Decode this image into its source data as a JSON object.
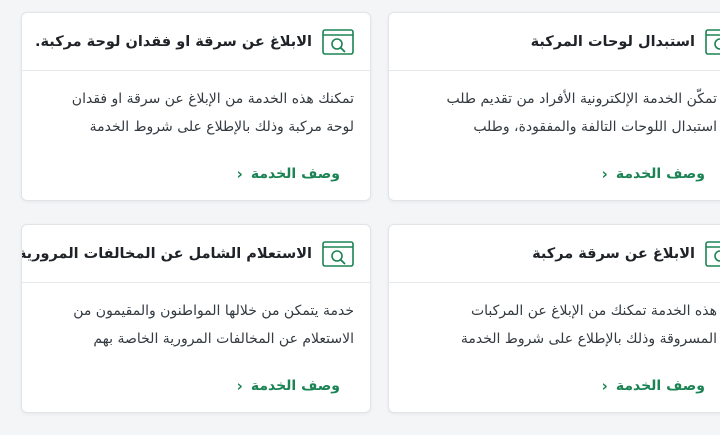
{
  "cards": [
    {
      "title": "الابلاغ عن سرقة او فقدان لوحة مركبة.",
      "line1": "تمكنك هذه الخدمة من الإبلاغ عن سرقة او فقدان",
      "line2": "لوحة مركبة وذلك بالإطلاع على شروط الخدمة",
      "link": "وصف الخدمة",
      "chevron": "‹"
    },
    {
      "title": "استبدال لوحات المركبة",
      "line1": "تمكّن الخدمة الإلكترونية الأفراد من تقديم طلب",
      "line2": "استبدال اللوحات التالفة والمفقودة، وطلب",
      "link": "وصف الخدمة",
      "chevron": "‹"
    },
    {
      "title": "الاستعلام الشامل عن المخالفات المرورية",
      "line1": "خدمة يتمكن من خلالها المواطنون والمقيمون من",
      "line2": "الاستعلام عن المخالفات المرورية الخاصة بهم",
      "link": "وصف الخدمة",
      "chevron": "‹"
    },
    {
      "title": "الابلاغ عن سرقة مركبة",
      "line1": "هذه الخدمة تمكنك من الإبلاغ عن المركبات",
      "line2": "المسروقة وذلك بالإطلاع على شروط الخدمة",
      "link": "وصف الخدمة",
      "chevron": "‹"
    }
  ],
  "colors": {
    "accent": "#1b8354",
    "border": "#e2e5e8",
    "background": "#f4f5f6"
  },
  "icon_name": "service-search-icon"
}
